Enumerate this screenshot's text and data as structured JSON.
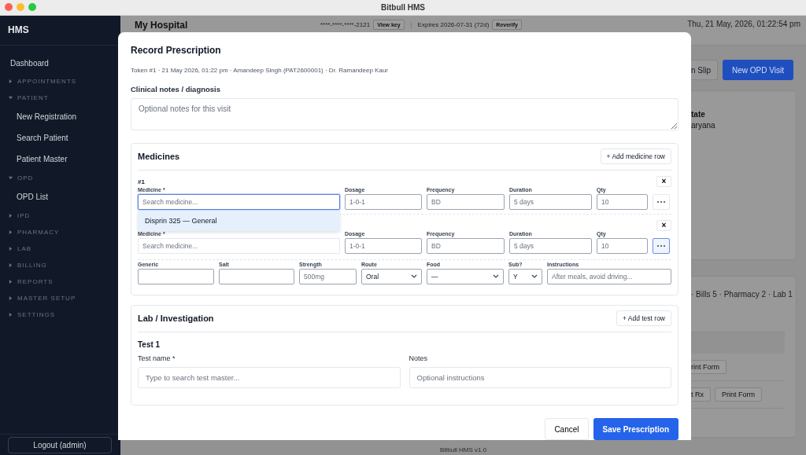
{
  "window": {
    "title": "Bitbull HMS"
  },
  "sidebar": {
    "brand": "HMS",
    "items": [
      {
        "kind": "link",
        "label": "Dashboard"
      },
      {
        "kind": "group",
        "label": "APPOINTMENTS",
        "expanded": false
      },
      {
        "kind": "group",
        "label": "PATIENT",
        "expanded": true,
        "children": [
          {
            "label": "New Registration"
          },
          {
            "label": "Search Patient"
          },
          {
            "label": "Patient Master"
          }
        ]
      },
      {
        "kind": "group",
        "label": "OPD",
        "expanded": true,
        "children": [
          {
            "label": "OPD List"
          }
        ]
      },
      {
        "kind": "group",
        "label": "IPD",
        "expanded": false
      },
      {
        "kind": "group",
        "label": "PHARMACY",
        "expanded": false
      },
      {
        "kind": "group",
        "label": "LAB",
        "expanded": false
      },
      {
        "kind": "group",
        "label": "BILLING",
        "expanded": false
      },
      {
        "kind": "group",
        "label": "REPORTS",
        "expanded": false
      },
      {
        "kind": "group",
        "label": "MASTER SETUP",
        "expanded": false
      },
      {
        "kind": "group",
        "label": "SETTINGS",
        "expanded": false
      }
    ],
    "logout": "Logout (admin)"
  },
  "header": {
    "hospital": "My Hospital",
    "license_key": "****-****-****-2121",
    "view_key": "View key",
    "expiry": "Expires 2026-07-31 (72d)",
    "reverify": "Reverify",
    "datetime": "Thu, 21 May, 2026, 01:22:54 pm"
  },
  "page": {
    "buttons": [
      {
        "label": "n Slip",
        "kind": "secondary"
      },
      {
        "label": "New OPD Visit",
        "kind": "primary"
      }
    ],
    "patient_card": {
      "label": "tate",
      "value": "aryana"
    },
    "visits_card": {
      "summary": "· Bills 5 · Pharmacy 2 · Lab 1",
      "rows": [
        {
          "buttons": [
            "rint Form"
          ]
        },
        {
          "buttons": [
            "t Rx",
            "Print Form"
          ]
        }
      ]
    },
    "footer": "Bitbull HMS v1.0"
  },
  "modal": {
    "title": "Record Prescription",
    "subtitle": "Token #1 · 21 May 2026, 01:22 pm · Amandeep Singh (PAT2600001) · Dr. Ramandeep Kaur",
    "notes_label": "Clinical notes / diagnosis",
    "notes_placeholder": "Optional notes for this visit",
    "medicines": {
      "title": "Medicines",
      "add_button": "+ Add medicine row",
      "rows": [
        {
          "number": "#1",
          "remove": "×",
          "expanded": false,
          "fields": [
            {
              "label": "Medicine *",
              "placeholder": "Search medicine...",
              "focused": true
            },
            {
              "label": "Dosage",
              "placeholder": "1-0-1",
              "focused": false
            },
            {
              "label": "Frequency",
              "placeholder": "BD",
              "focused": false
            },
            {
              "label": "Duration",
              "placeholder": "5 days",
              "focused": false
            },
            {
              "label": "Qty",
              "placeholder": "10",
              "focused": false
            }
          ],
          "suggestions": [
            {
              "text": "Disprin 325 — General",
              "selected": true
            }
          ]
        },
        {
          "remove": "×",
          "expanded": true,
          "fields": [
            {
              "label": "Medicine *",
              "placeholder": "Search medicine...",
              "focused": false
            },
            {
              "label": "Dosage",
              "placeholder": "1-0-1",
              "focused": false
            },
            {
              "label": "Frequency",
              "placeholder": "BD",
              "focused": false
            },
            {
              "label": "Duration",
              "placeholder": "5 days",
              "focused": false
            },
            {
              "label": "Qty",
              "placeholder": "10",
              "focused": false
            }
          ],
          "extra_fields": [
            {
              "kind": "input",
              "label": "Generic"
            },
            {
              "kind": "input",
              "label": "Salt"
            },
            {
              "kind": "input",
              "label": "Strength",
              "placeholder": "500mg"
            },
            {
              "kind": "select",
              "label": "Route",
              "value": "Oral"
            },
            {
              "kind": "select",
              "label": "Food",
              "value": "—"
            },
            {
              "kind": "select",
              "label": "Sub?",
              "value": "Y"
            },
            {
              "kind": "input",
              "label": "Instructions",
              "placeholder": "After meals, avoid driving..."
            }
          ]
        }
      ]
    },
    "lab": {
      "title": "Lab / Investigation",
      "add_button": "+ Add test row",
      "tests": [
        {
          "title": "Test 1",
          "name_label": "Test name *",
          "name_placeholder": "Type to search test master...",
          "notes_label": "Notes",
          "notes_placeholder": "Optional instructions"
        }
      ]
    },
    "footer": {
      "cancel": "Cancel",
      "save": "Save Prescription"
    }
  }
}
